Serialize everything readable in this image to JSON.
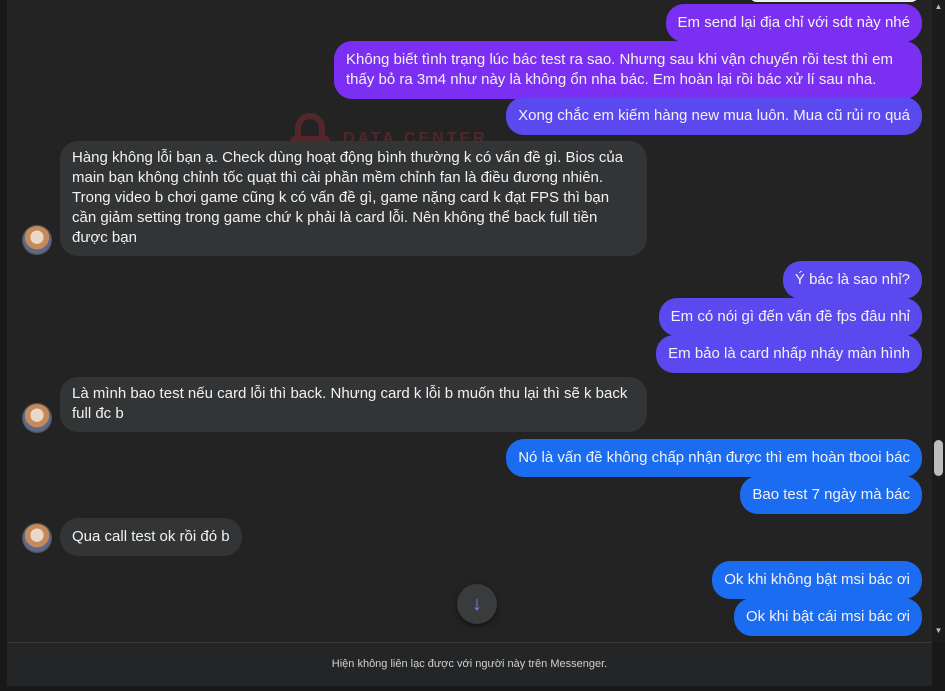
{
  "messages": [
    {
      "dir": "out",
      "text": "Em send lại địa chỉ với sdt này nhé"
    },
    {
      "dir": "out",
      "text": "Không biết tình trạng lúc bác test ra sao. Nhưng sau khi vận chuyển rồi test thì em thấy bỏ ra 3m4 như này là không ổn nha bác. Em hoàn lại rồi bác xử lí sau nha."
    },
    {
      "dir": "out",
      "text": "Xong chắc em kiếm hàng new mua luôn. Mua cũ rủi ro quá"
    },
    {
      "dir": "in",
      "text": "Hàng không lỗi bạn ạ. Check dùng hoạt động bình thường k có vấn đề gì. Bios của main bạn không chỉnh tốc quạt thì cài phần mềm chỉnh fan là điều đương nhiên. Trong video b chơi game cũng k có vấn đề gì, game nặng card k đạt FPS thì bạn cần giảm setting trong game chứ k phải là card lỗi. Nên không thể back full tiền được bạn"
    },
    {
      "dir": "out",
      "text": "Ý bác là sao nhỉ?"
    },
    {
      "dir": "out",
      "text": "Em có nói gì đến vấn đề fps đâu nhỉ"
    },
    {
      "dir": "out",
      "text": "Em bảo là card nhấp nháy màn hình"
    },
    {
      "dir": "in",
      "text": "Là mình bao test nếu card lỗi thì back. Nhưng card k lỗi b muốn thu lại thì sẽ k back full đc b"
    },
    {
      "dir": "out",
      "text": "Nó là vấn đề không chấp nhận được thì em hoàn tbooi bác"
    },
    {
      "dir": "out",
      "text": "Bao test 7 ngày mà bác"
    },
    {
      "dir": "in",
      "text": "Qua call test ok rồi đó b"
    },
    {
      "dir": "out",
      "text": "Ok khi không bật msi bác ơi"
    },
    {
      "dir": "out",
      "text": "Ok khi bật cái msi bác ơi"
    }
  ],
  "watermark": {
    "line1": "DATA CENTER",
    "icon": "lock-icon"
  },
  "scroll_down_icon": "arrow-down-icon",
  "footer": {
    "notice": "Hiện không liên lạc được với người này trên Messenger."
  },
  "colors": {
    "purple": "#7b2ff2",
    "violet": "#5b49f0",
    "blue": "#1b6cf0",
    "incoming": "#333435",
    "background": "#232323"
  }
}
